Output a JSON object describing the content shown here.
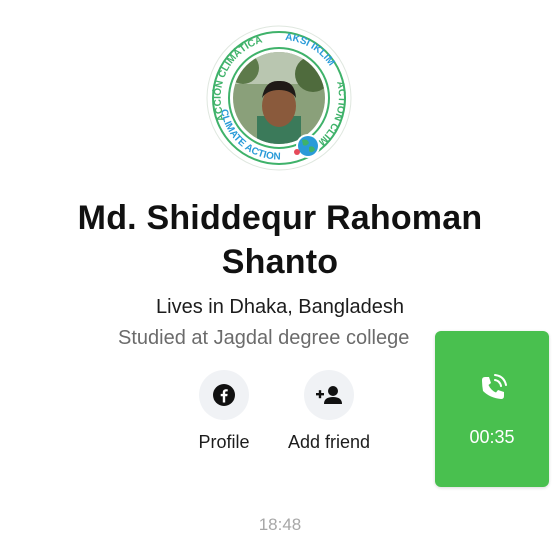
{
  "profile": {
    "name": "Md. Shiddequr Rahoman Shanto",
    "lives": "Lives in Dhaka, Bangladesh",
    "studied": "Studied at Jagdal degree college",
    "frame_text": {
      "top_left": "ACCIÓN CLIMÁTICA",
      "top_right": "AKSI IKLIM",
      "right": "ACTION CLIMAT",
      "bottom": "CLIMATE ACTION"
    }
  },
  "actions": {
    "profile_label": "Profile",
    "add_friend_label": "Add friend"
  },
  "message": {
    "time": "18:48"
  },
  "call": {
    "timer": "00:35"
  },
  "icons": {
    "profile": "facebook-icon",
    "add_friend": "add-friend-icon",
    "call": "phone-call-icon"
  },
  "colors": {
    "call_green": "#49c04f",
    "frame_green": "#3fb26a",
    "frame_blue": "#2a9bd8"
  }
}
